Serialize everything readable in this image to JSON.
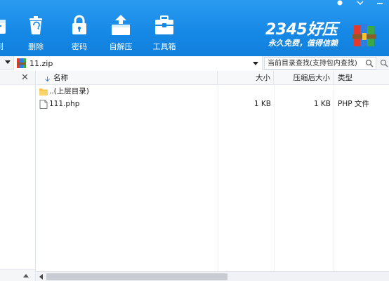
{
  "window": {
    "controls": [
      {
        "name": "help-icon",
        "glyph": "●"
      },
      {
        "name": "menu-icon",
        "glyph": "▾"
      },
      {
        "name": "minimize-icon",
        "glyph": "—"
      }
    ]
  },
  "toolbar": {
    "buttons": [
      {
        "id": "extract",
        "label": "到"
      },
      {
        "id": "delete",
        "label": "删除"
      },
      {
        "id": "password",
        "label": "密码"
      },
      {
        "id": "sfx",
        "label": "自解压"
      },
      {
        "id": "tools",
        "label": "工具箱"
      }
    ]
  },
  "brand": {
    "main": "2345好压",
    "slogan": "永久免费，值得信赖"
  },
  "addressbar": {
    "path": "11.zip",
    "search_placeholder": "当前目录查找(支持包内查找)"
  },
  "leftpanel": {
    "close_glyph": "✕"
  },
  "filelist": {
    "columns": {
      "name": "名称",
      "size": "大小",
      "compressed": "压缩后大小",
      "type": "类型"
    },
    "rows": [
      {
        "kind": "folder",
        "name": "..(上层目录)",
        "size": "",
        "compressed": "",
        "type": ""
      },
      {
        "kind": "file",
        "name": "111.php",
        "size": "1 KB",
        "compressed": "1 KB",
        "type": "PHP 文件"
      }
    ]
  },
  "colors": {
    "toolbar_blue": "#1588e6",
    "folder_yellow": "#f5c242"
  }
}
